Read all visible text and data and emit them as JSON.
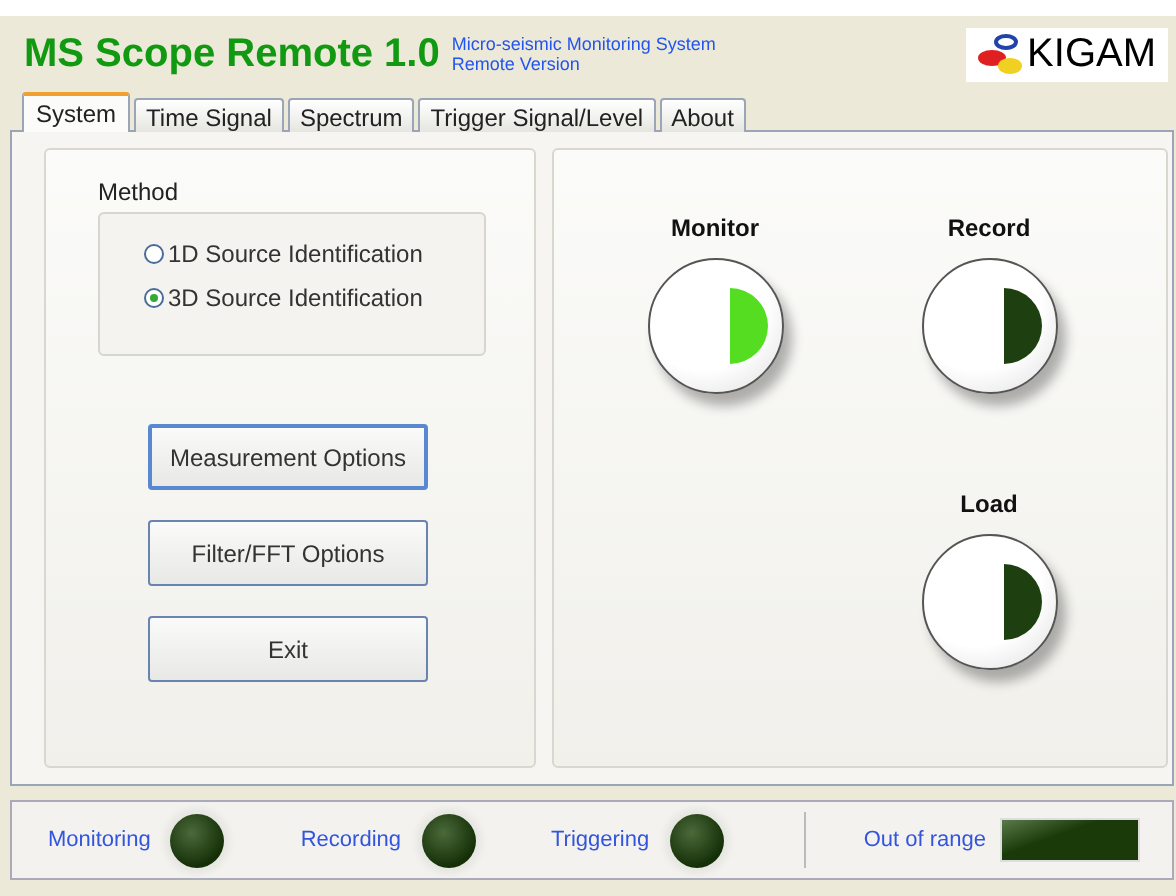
{
  "header": {
    "title": "MS Scope Remote 1.0",
    "subtitle_lines": [
      "Micro-seismic Monitoring System",
      "Remote Version"
    ],
    "logo_text": "KIGAM"
  },
  "tabs": [
    {
      "label": "System",
      "selected": true
    },
    {
      "label": "Time Signal",
      "selected": false
    },
    {
      "label": "Spectrum",
      "selected": false
    },
    {
      "label": "Trigger Signal/Level",
      "selected": false
    },
    {
      "label": "About",
      "selected": false
    }
  ],
  "method": {
    "label": "Method",
    "options": [
      {
        "label": "1D Source Identification",
        "selected": false
      },
      {
        "label": "3D Source Identification",
        "selected": true
      }
    ]
  },
  "buttons": [
    {
      "label": "Measurement Options",
      "focused": true
    },
    {
      "label": "Filter/FFT Options",
      "focused": false
    },
    {
      "label": "Exit",
      "focused": false
    }
  ],
  "controls": [
    {
      "label": "Monitor",
      "on": true
    },
    {
      "label": "Record",
      "on": false
    },
    {
      "label": "Load",
      "on": false
    }
  ],
  "status_bar": {
    "indicators": [
      {
        "label": "Monitoring",
        "on": false
      },
      {
        "label": "Recording",
        "on": false
      },
      {
        "label": "Triggering",
        "on": false
      }
    ],
    "out_of_range": {
      "label": "Out of range",
      "on": false
    }
  }
}
